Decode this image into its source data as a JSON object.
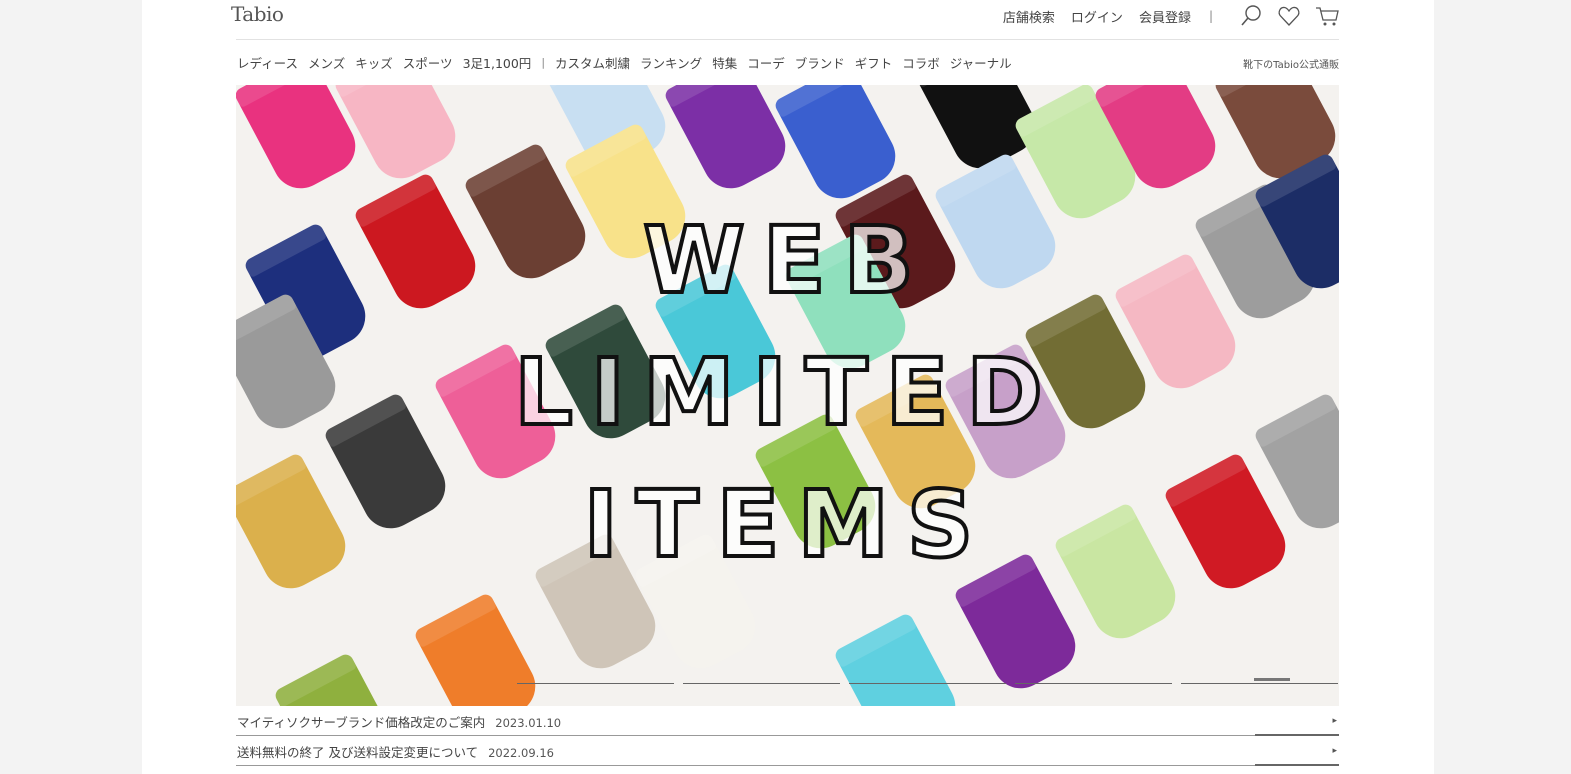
{
  "header": {
    "logo": "Tabio",
    "util_links": [
      "店舗検索",
      "ログイン",
      "会員登録"
    ],
    "separator": "|",
    "icons": [
      "search-icon",
      "heart-icon",
      "cart-icon"
    ]
  },
  "gnav": {
    "items_a": [
      "レディース",
      "メンズ",
      "キッズ",
      "スポーツ",
      "3足1,100円"
    ],
    "separator": "|",
    "items_b": [
      "カスタム刺繍",
      "ランキング",
      "特集",
      "コーデ",
      "ブランド",
      "ギフト",
      "コラボ",
      "ジャーナル"
    ],
    "official": "靴下のTabio公式通販"
  },
  "hero": {
    "lines": [
      "WEB",
      "LIMITED",
      "ITEMS"
    ],
    "slide_count": 5,
    "active_slide": 5
  },
  "news": [
    {
      "title": "マイティソクサーブランド価格改定のご案内",
      "date": "2023.01.10",
      "arrow": "▸"
    },
    {
      "title": "送料無料の終了 及び送料設定変更について",
      "date": "2022.09.16",
      "arrow": "▸"
    }
  ]
}
